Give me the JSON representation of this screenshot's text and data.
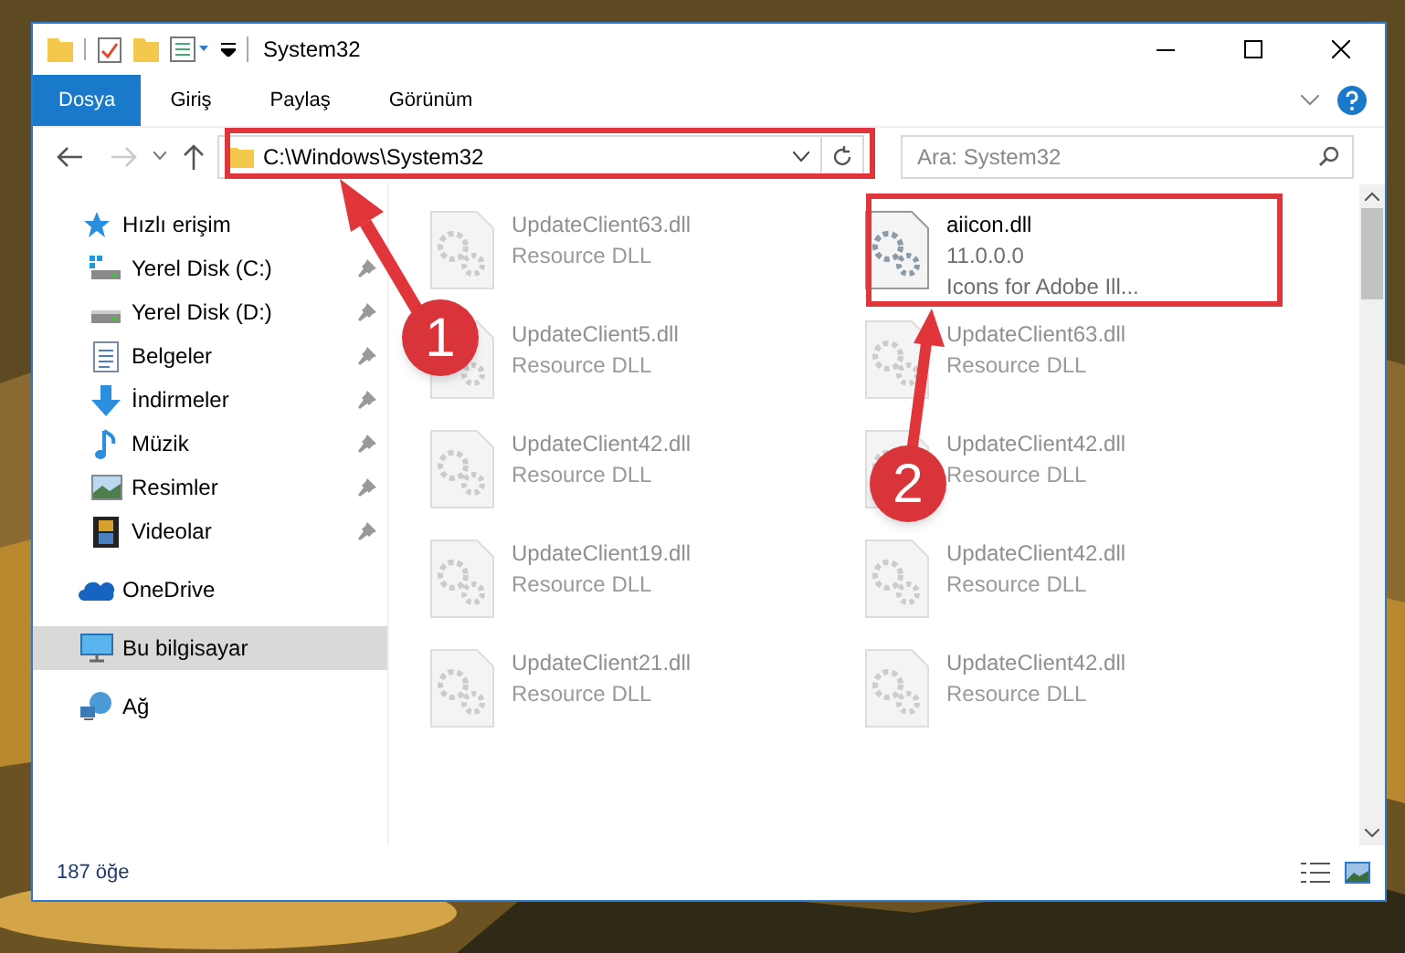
{
  "window": {
    "title": "System32"
  },
  "ribbon_tabs": [
    {
      "label": "Dosya",
      "kind": "file",
      "selected": false
    },
    {
      "label": "Giriş",
      "kind": "tab",
      "selected": false
    },
    {
      "label": "Paylaş",
      "kind": "tab",
      "selected": false
    },
    {
      "label": "Görünüm",
      "kind": "tab",
      "selected": false
    }
  ],
  "address": {
    "path": "C:\\Windows\\System32"
  },
  "search": {
    "placeholder": "Ara: System32"
  },
  "navigation": [
    {
      "label": "Hızlı erişim",
      "selected": false,
      "children": [
        {
          "label": "Yerel Disk (C:)",
          "pinned": true
        },
        {
          "label": "Yerel Disk (D:)",
          "pinned": true
        },
        {
          "label": "Belgeler",
          "pinned": true
        },
        {
          "label": "İndirmeler",
          "pinned": true
        },
        {
          "label": "Müzik",
          "pinned": true
        },
        {
          "label": "Resimler",
          "pinned": true
        },
        {
          "label": "Videolar",
          "pinned": true
        }
      ]
    },
    {
      "label": "OneDrive",
      "selected": false
    },
    {
      "label": "Bu bilgisayar",
      "selected": true
    },
    {
      "label": "Ağ",
      "selected": false
    }
  ],
  "files": [
    {
      "name": "UpdateClient63.dll",
      "details": [
        "Resource DLL"
      ],
      "blurred": true
    },
    {
      "name": "aiicon.dll",
      "details": [
        "11.0.0.0",
        "Icons for Adobe Ill..."
      ],
      "blurred": false
    },
    {
      "name": "UpdateClient5.dll",
      "details": [
        "Resource DLL"
      ],
      "blurred": true
    },
    {
      "name": "UpdateClient63.dll",
      "details": [
        "Resource DLL"
      ],
      "blurred": true
    },
    {
      "name": "UpdateClient42.dll",
      "details": [
        "Resource DLL"
      ],
      "blurred": true
    },
    {
      "name": "UpdateClient42.dll",
      "details": [
        "Resource DLL"
      ],
      "blurred": true
    },
    {
      "name": "UpdateClient19.dll",
      "details": [
        "Resource DLL"
      ],
      "blurred": true
    },
    {
      "name": "UpdateClient42.dll",
      "details": [
        "Resource DLL"
      ],
      "blurred": true
    },
    {
      "name": "UpdateClient21.dll",
      "details": [
        "Resource DLL"
      ],
      "blurred": true
    },
    {
      "name": "UpdateClient42.dll",
      "details": [
        "Resource DLL"
      ],
      "blurred": true
    }
  ],
  "status_bar": {
    "item_count": "187 öğe"
  },
  "annotations": [
    {
      "label": "1"
    },
    {
      "label": "2"
    }
  ]
}
